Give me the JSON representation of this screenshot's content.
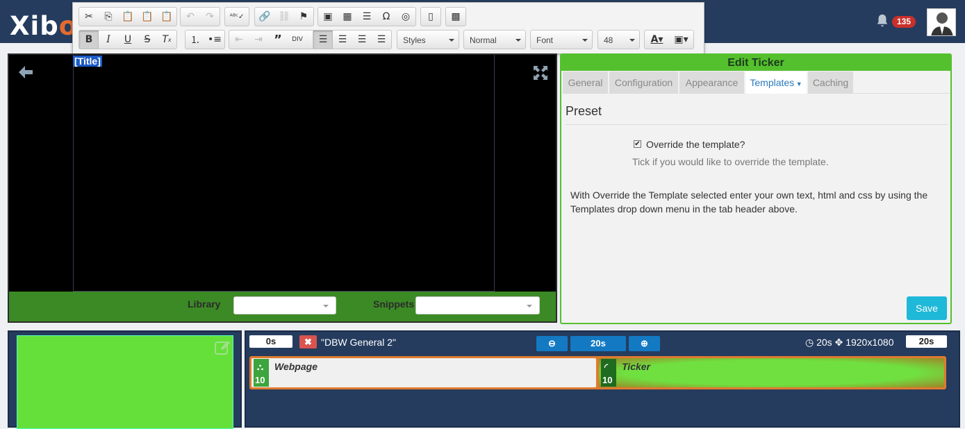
{
  "app": {
    "logo_main": "Xib",
    "logo_end": "o",
    "notification_count": "135"
  },
  "editor": {
    "title_placeholder": "[Title]",
    "styles_label": "Styles",
    "format_label": "Normal",
    "font_label": "Font",
    "size_label": "48",
    "library_label": "Library",
    "snippets_label": "Snippets"
  },
  "panel": {
    "title": "Edit Ticker",
    "tabs": [
      "General",
      "Configuration",
      "Appearance",
      "Templates",
      "Caching"
    ],
    "active_tab": "Templates",
    "section": "Preset",
    "override_label": "Override the template?",
    "override_help": "Tick if you would like to override the template.",
    "info": "With Override the Template selected enter your own text, html and css by using the Templates drop down menu in the tab header above.",
    "save_label": "Save"
  },
  "timeline": {
    "start": "0s",
    "layout_name": "\"DBW General 2\"",
    "zoom_value": "20s",
    "duration": "20s",
    "resolution": "1920x1080",
    "end": "20s",
    "widgets": [
      {
        "name": "Webpage",
        "num": "10",
        "icon": "webpage-icon"
      },
      {
        "name": "Ticker",
        "num": "10",
        "icon": "rss-icon"
      }
    ]
  },
  "colors": {
    "topbar": "#253c5e",
    "green": "#54c02e",
    "orange": "#e07a2e",
    "blue": "#1479c3"
  }
}
